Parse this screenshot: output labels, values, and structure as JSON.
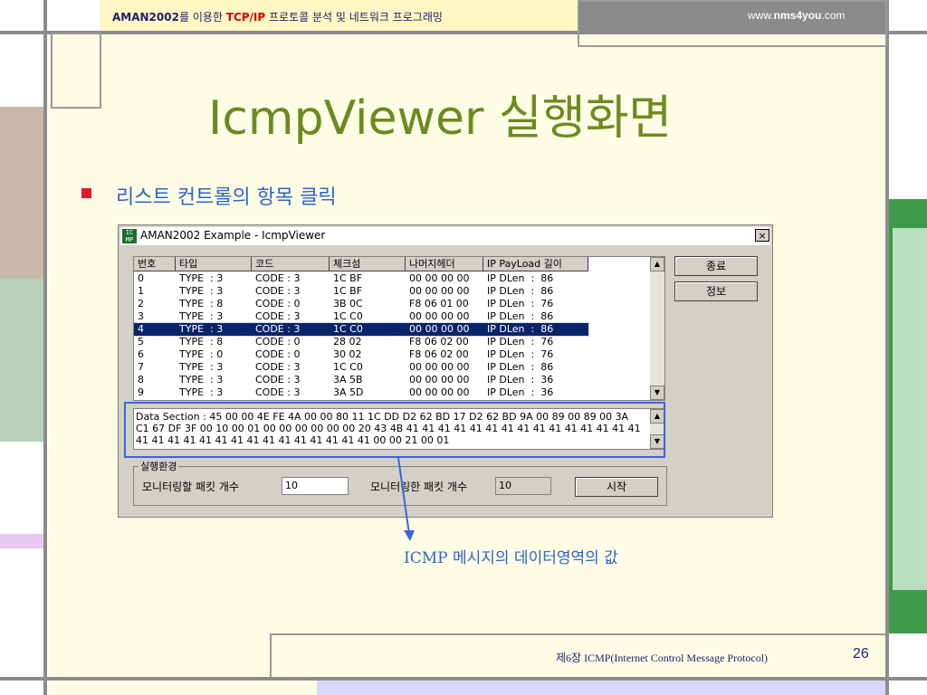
{
  "header": {
    "brand": "AMAN2002",
    "mid1": "를 이용한 ",
    "tcpip": "TCP/IP",
    "mid2": " 프로토콜 분석 및 네트워크 프로그래밍",
    "site_prefix": "www.",
    "site_bold": "nms4you",
    "site_suffix": ".com"
  },
  "slide": {
    "title": "IcmpViewer 실행화면",
    "bullet": "리스트 컨트롤의 항목 클릭",
    "caption": "ICMP 메시지의 데이터영역의 값"
  },
  "window": {
    "title": "AMAN2002 Example - IcmpViewer",
    "icon_text": "IC MP",
    "close": "×",
    "columns": [
      "번호",
      "타입",
      "코드",
      "체크섬",
      "나머지헤더",
      "IP PayLoad 길이"
    ],
    "rows": [
      [
        "0",
        "TYPE  : 3",
        "CODE : 3",
        "1C BF",
        "00 00 00 00",
        "IP DLen  :  86"
      ],
      [
        "1",
        "TYPE  : 3",
        "CODE : 3",
        "1C BF",
        "00 00 00 00",
        "IP DLen  :  86"
      ],
      [
        "2",
        "TYPE  : 8",
        "CODE : 0",
        "3B 0C",
        "F8 06 01 00",
        "IP DLen  :  76"
      ],
      [
        "3",
        "TYPE  : 3",
        "CODE : 3",
        "1C C0",
        "00 00 00 00",
        "IP DLen  :  86"
      ],
      [
        "4",
        "TYPE  : 3",
        "CODE : 3",
        "1C C0",
        "00 00 00 00",
        "IP DLen  :  86"
      ],
      [
        "5",
        "TYPE  : 8",
        "CODE : 0",
        "28 02",
        "F8 06 02 00",
        "IP DLen  :  76"
      ],
      [
        "6",
        "TYPE  : 0",
        "CODE : 0",
        "30 02",
        "F8 06 02 00",
        "IP DLen  :  76"
      ],
      [
        "7",
        "TYPE  : 3",
        "CODE : 3",
        "1C C0",
        "00 00 00 00",
        "IP DLen  :  86"
      ],
      [
        "8",
        "TYPE  : 3",
        "CODE : 3",
        "3A 5B",
        "00 00 00 00",
        "IP DLen  :  36"
      ],
      [
        "9",
        "TYPE  : 3",
        "CODE : 3",
        "3A 5D",
        "00 00 00 00",
        "IP DLen  :  36"
      ]
    ],
    "selected_row": 4,
    "buttons": {
      "exit": "종료",
      "info": "정보",
      "start": "시작"
    },
    "data_section": "Data Section : 45 00 00 4E FE 4A 00 00 80 11 1C DD D2 62 BD 17 D2 62 BD 9A 00 89 00 89 00 3A\nC1 67 DF 3F 00 10 00 01 00 00 00 00 00 00 20 43 4B 41 41 41 41 41 41 41 41 41 41 41 41 41 41 41\n41 41 41 41 41 41 41 41 41 41 41 41 41 41 41 00 00 21 00 01",
    "group": {
      "label": "실행환경",
      "count_label": "모니터링할 패킷 개수",
      "count_value": "10",
      "done_label": "모니터링한 패킷 개수",
      "done_value": "10"
    }
  },
  "footer": {
    "chapter": "제6장  ICMP(Internet Control Message Protocol)",
    "page": "26"
  },
  "colors": {
    "title": "#6e8a1f",
    "bullet": "#e8152e",
    "text_blue": "#2f63c8",
    "selection": "#0a246a",
    "highlight": "#3a66d6"
  }
}
